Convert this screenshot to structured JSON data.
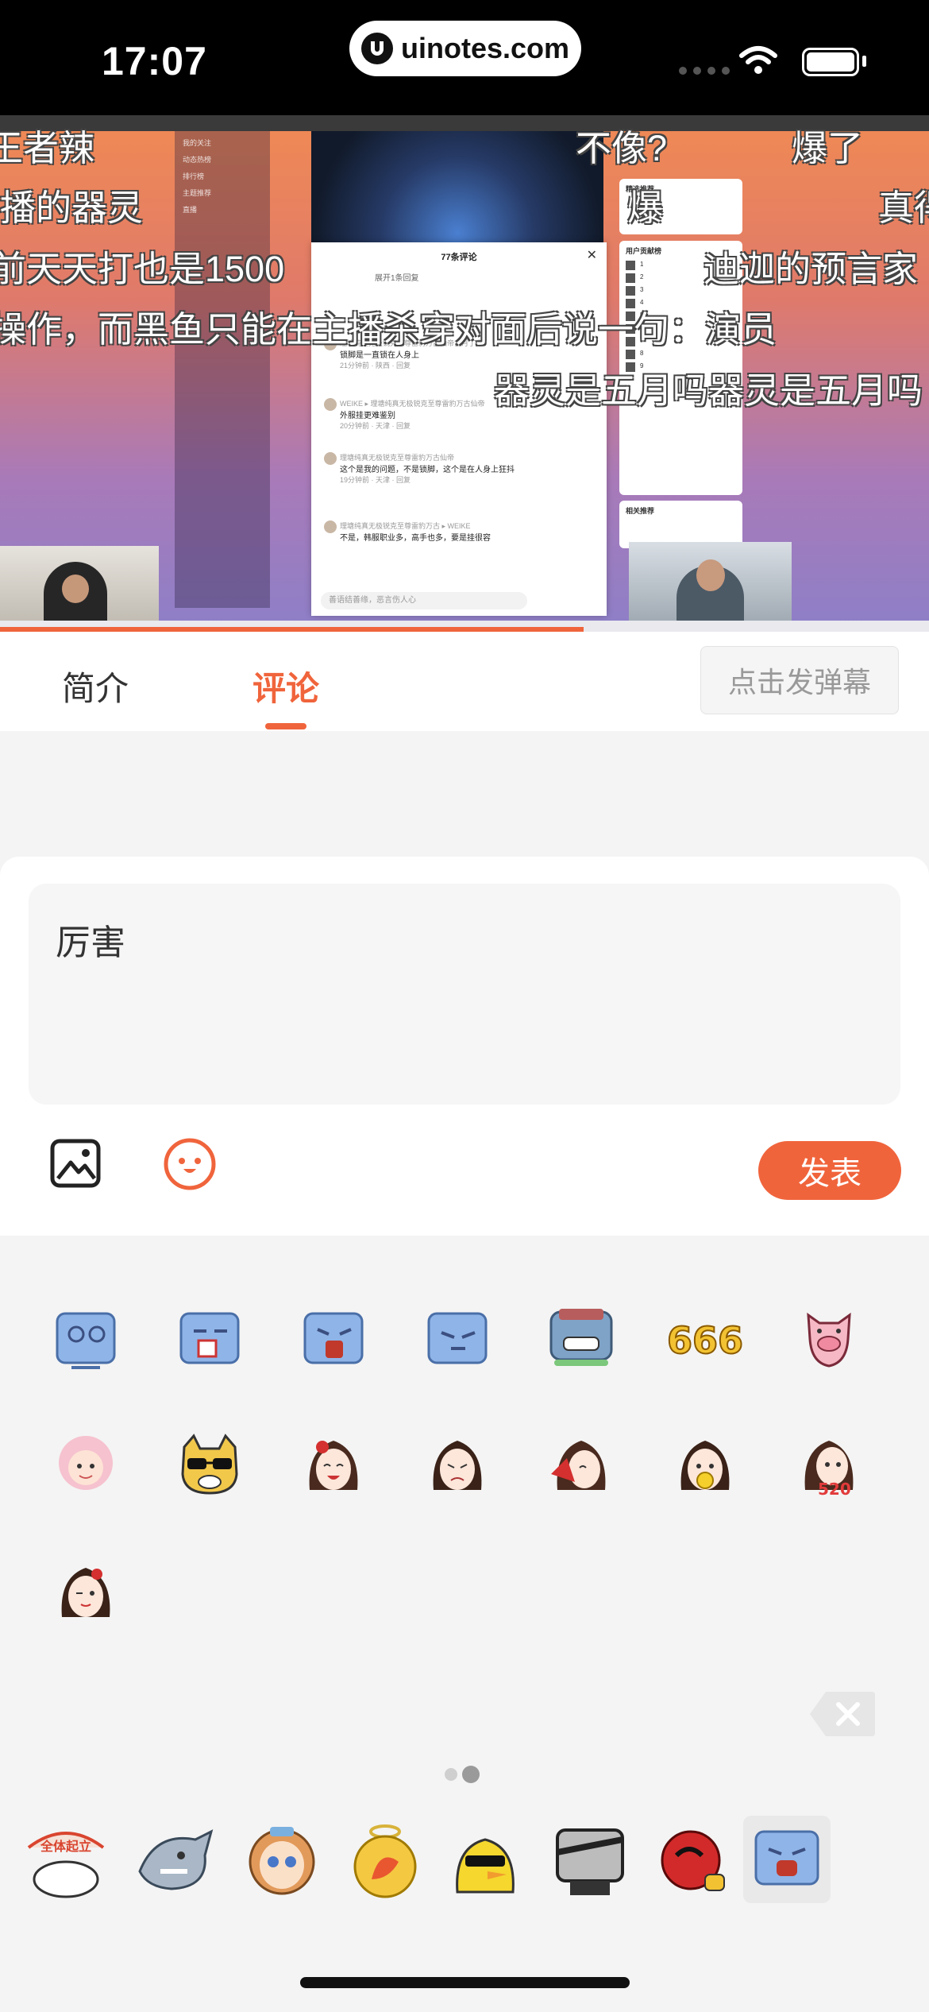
{
  "status_bar": {
    "time": "17:07",
    "url": "uinotes.com"
  },
  "video": {
    "modal_title": "77条评论",
    "modal_expand": "展开1条回复",
    "modal_comments": [
      {
        "user": "理塘纯真无极锐克至尊雷豹万古仙帝古月丁真",
        "text": "锁脚是一直锁在人身上",
        "meta": "21分钟前 · 陕西 · 回复"
      },
      {
        "user": "WEIKE ▸ 理塘纯真无极锐克至尊雷豹万古仙帝",
        "text": "外服挂更难鉴别",
        "meta": "20分钟前 · 天津 · 回复"
      },
      {
        "user": "理塘纯真无极锐克至尊雷豹万古仙帝",
        "text": "这个是我的问题，不是锁脚，这个是在人身上狂抖",
        "meta": "19分钟前 · 天津 · 回复"
      },
      {
        "user": "理塘纯真无极锐克至尊雷豹万古 ▸ WEIKE",
        "text": "不是，韩服职业多，高手也多，要是挂很容",
        "meta": ""
      }
    ],
    "modal_input_placeholder": "善语结善缘，恶言伤人心",
    "sidebar_items": [
      "我的关注",
      "动态热榜",
      "排行榜",
      "主题推荐",
      "直播"
    ],
    "rank_titles": [
      "精选推荐",
      "用户贡献榜",
      "相关推荐"
    ],
    "danmaku": [
      "王者辣",
      "不像?",
      "爆了",
      "播的器灵",
      "爆",
      "真得",
      "前天天打也是1500",
      "迪迦的预言家",
      "操作，而黑鱼只能在主播杀穿对面后说一句：演员",
      "器灵是五月吗器灵是五月吗"
    ]
  },
  "tabs": {
    "intro": "简介",
    "comment": "评论",
    "danmaku_button": "点击发弹幕"
  },
  "composer": {
    "input_value": "厉害",
    "send_label": "发表"
  },
  "emoji_panel": {
    "rows": [
      [
        "blue-cube-dizzy",
        "blue-cube-bleeding",
        "blue-cube-shout",
        "blue-cube-sleep",
        "robot-cat-grin",
        "gold-666",
        "pig-head"
      ],
      [
        "pink-hair-girl",
        "cool-dog-sunglasses",
        "girl-laugh",
        "girl-cry",
        "girl-fan",
        "girl-eat",
        "girl-520"
      ],
      [
        "girl-wink"
      ]
    ],
    "page_index": "2/2",
    "packs": [
      "全体起立",
      "shark",
      "girl-face",
      "golden-coin",
      "duck-sunglasses",
      "robot-head",
      "red-ball",
      "blue-cube"
    ],
    "colors": {
      "accent": "#f0643c",
      "cube": "#8fb4e8"
    }
  }
}
